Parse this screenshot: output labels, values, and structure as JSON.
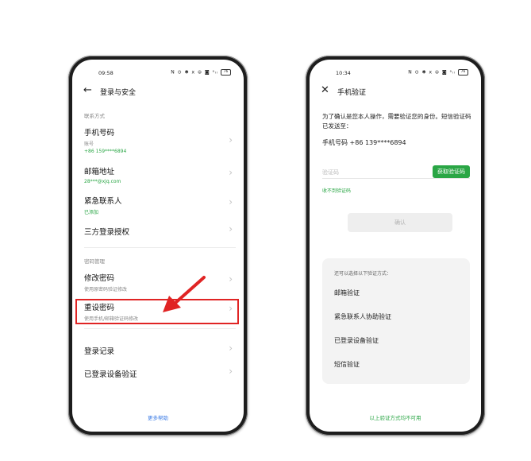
{
  "left_screen": {
    "status": {
      "time": "09:58",
      "icons": "N ⊙ ✱ ⅹ ⊜ ◙ ᵃᵢₗ",
      "battery": "76"
    },
    "nav": {
      "title": "登录与安全"
    },
    "section_contact": "联系方式",
    "items": [
      {
        "title": "手机号码",
        "sub1": "账号",
        "sub2": "+86 159****6894"
      },
      {
        "title": "邮箱地址",
        "sub": "28***@xjq.com"
      },
      {
        "title": "紧急联系人",
        "sub": "已添加"
      },
      {
        "title": "三方登录授权"
      }
    ],
    "section_password": "密码管理",
    "pw_items": [
      {
        "title": "修改密码",
        "sub": "使用原密码验证修改"
      },
      {
        "title": "重设密码",
        "sub": "使用手机/邮箱验证码修改"
      }
    ],
    "other_items": [
      {
        "title": "登录记录"
      },
      {
        "title": "已登录设备验证"
      }
    ],
    "help": "更多帮助"
  },
  "right_screen": {
    "status": {
      "time": "10:34",
      "icons": "N ⊙ ✱ ⅹ ⊜ ◙ ᵃᵢₗ",
      "battery": "76"
    },
    "nav": {
      "title": "手机验证"
    },
    "description": "为了确认是您本人操作，需要验证您的身份。短信验证码已发送至：",
    "phone_line": "手机号码 +86 139****6894",
    "code_placeholder": "验证码",
    "get_code": "获取验证码",
    "no_code": "收不到验证码",
    "confirm": "确认",
    "alt_title": "还可以选择以下验证方式：",
    "alt_items": [
      "邮箱验证",
      "紧急联系人协助验证",
      "已登录设备验证",
      "短信验证"
    ],
    "bottom_link": "以上验证方式均不可用"
  },
  "colors": {
    "accent_green": "#2aa645",
    "link_blue": "#3b7be5",
    "annotation_red": "#e02424"
  }
}
